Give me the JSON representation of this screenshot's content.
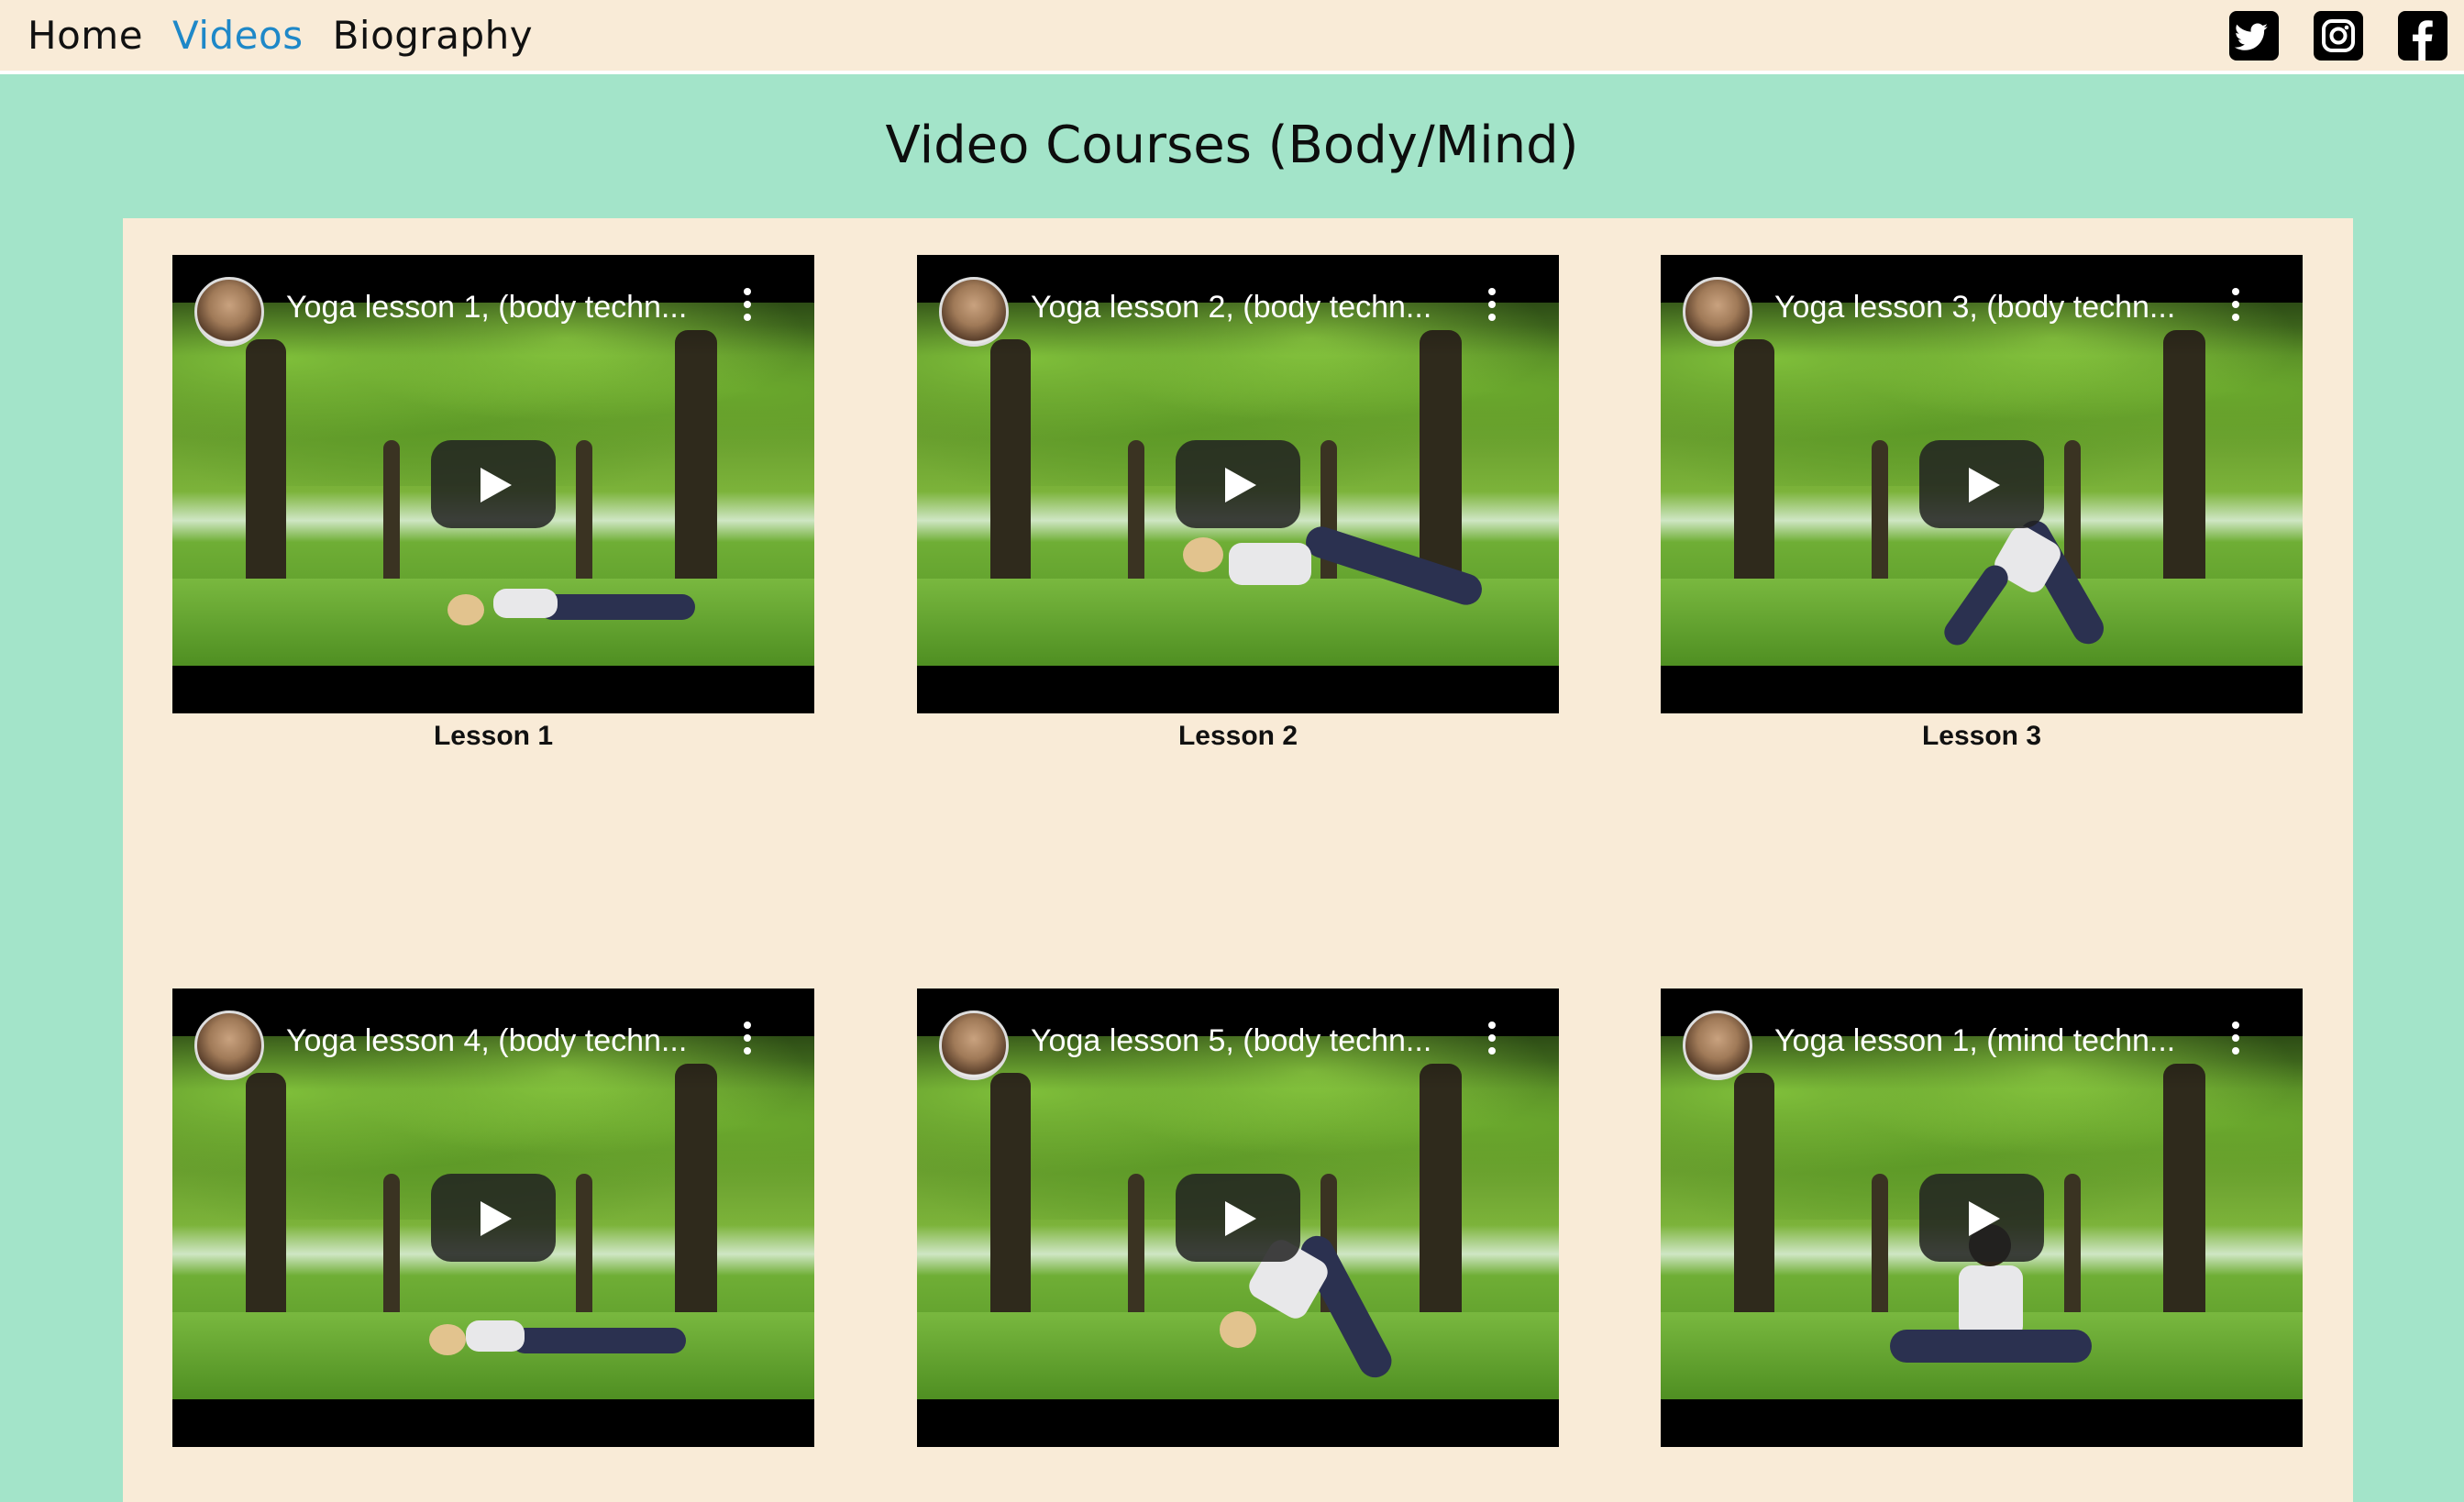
{
  "nav": {
    "items": [
      {
        "label": "Home",
        "active": false
      },
      {
        "label": "Videos",
        "active": true
      },
      {
        "label": "Biography",
        "active": false
      }
    ],
    "active_color": "#1e88c8"
  },
  "social": [
    "twitter-icon",
    "instagram-icon",
    "facebook-icon"
  ],
  "page": {
    "title": "Video Courses (Body/Mind)",
    "background": "#a3e4c9",
    "panel_color": "#f9ebd7"
  },
  "videos": [
    {
      "title": "Yoga lesson 1, (body techn...",
      "caption": "Lesson 1"
    },
    {
      "title": "Yoga lesson 2, (body techn...",
      "caption": "Lesson 2"
    },
    {
      "title": "Yoga lesson 3, (body techn...",
      "caption": "Lesson 3"
    },
    {
      "title": "Yoga lesson 4, (body techn...",
      "caption": ""
    },
    {
      "title": "Yoga lesson 5, (body techn...",
      "caption": ""
    },
    {
      "title": "Yoga lesson 1, (mind techn...",
      "caption": ""
    }
  ]
}
